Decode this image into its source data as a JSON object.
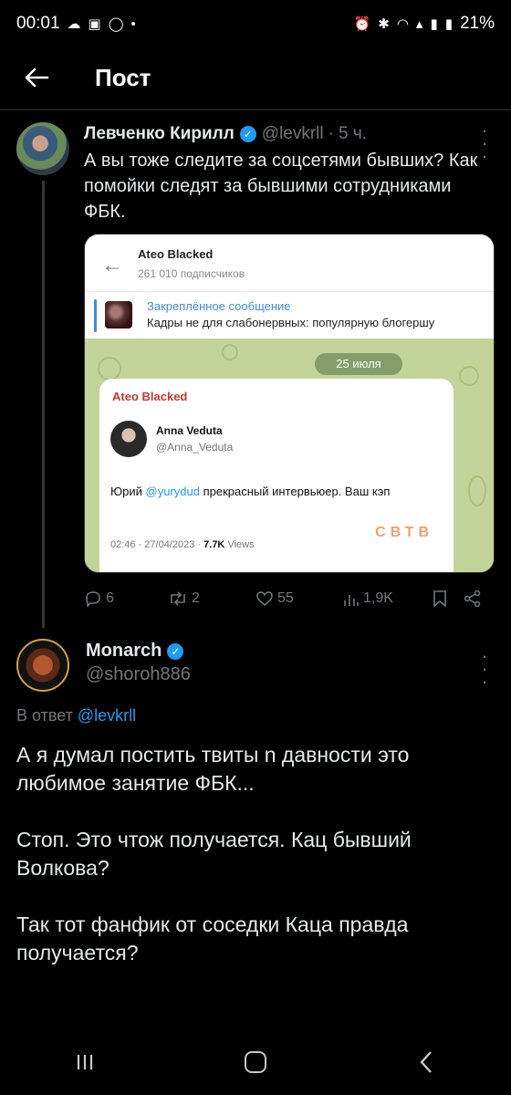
{
  "status_bar": {
    "time": "00:01",
    "battery": "21%",
    "icons": [
      "cloud-icon",
      "screenshot-icon",
      "whatsapp-icon",
      "dot-icon",
      "alarm-icon",
      "bluetooth-icon",
      "wifi-icon",
      "volte-icon",
      "signal-icon",
      "signal-2-icon"
    ]
  },
  "header": {
    "title": "Пост"
  },
  "tweet": {
    "author_name": "Левченко Кирилл",
    "handle": "@levkrll",
    "separator": "·",
    "time": "5 ч.",
    "text": "А вы тоже следите за соцсетями бывших? Как помойки следят за бывшими сотрудниками ФБК.",
    "embed": {
      "channel_name": "Ateo Blacked",
      "subscribers": "261 010 подписчиков",
      "pinned_title": "Закреплённое сообщение",
      "pinned_text": "Кадры не для слабонервных: популярную блогершу",
      "date": "25 июля",
      "bubble_channel": "Ateo Blacked",
      "inner_name": "Anna Veduta",
      "inner_handle": "@Anna_Veduta",
      "inner_text_before": "Юрий ",
      "inner_mention": "@yurydud",
      "inner_text_after": " прекрасный интервьюер. Ваш кэп",
      "inner_meta_date": "02:46 · 27/04/2023 · ",
      "inner_meta_views": "7.7K",
      "inner_meta_label": " Views",
      "watermark": "СВТВ"
    },
    "actions": {
      "replies": "6",
      "retweets": "2",
      "likes": "55",
      "views": "1,9K"
    }
  },
  "reply": {
    "author_name": "Monarch",
    "handle": "@shoroh886",
    "reply_to_prefix": "В ответ ",
    "reply_to_mention": "@levkrll",
    "paragraphs": [
      "А я думал постить твиты n давности это любимое занятие ФБК...",
      "Стоп. Это чтож получается. Кац бывший Волкова?",
      "Так тот фанфик от соседки Каца правда получается?"
    ]
  },
  "colors": {
    "accent": "#1d9bf0",
    "muted": "#71767b",
    "background": "#000000",
    "telegram_red": "#c4372f"
  }
}
